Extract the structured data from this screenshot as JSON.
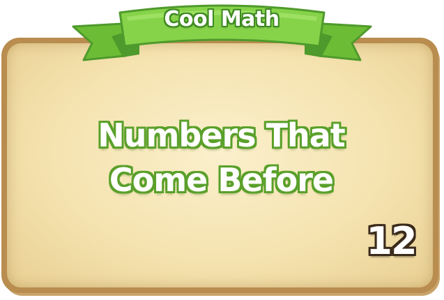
{
  "ribbon": {
    "title": "Cool Math"
  },
  "card": {
    "title_line1": "Numbers That",
    "title_line2": "Come Before",
    "number": "12"
  },
  "colors": {
    "ribbon_green": "#7ccb3f",
    "ribbon_dark": "#4f9a2c",
    "card_border": "#b98d4f",
    "card_fill": "#f5e3b0",
    "title_outline": "#5aa02a",
    "number_outline": "#3a2a1a"
  }
}
